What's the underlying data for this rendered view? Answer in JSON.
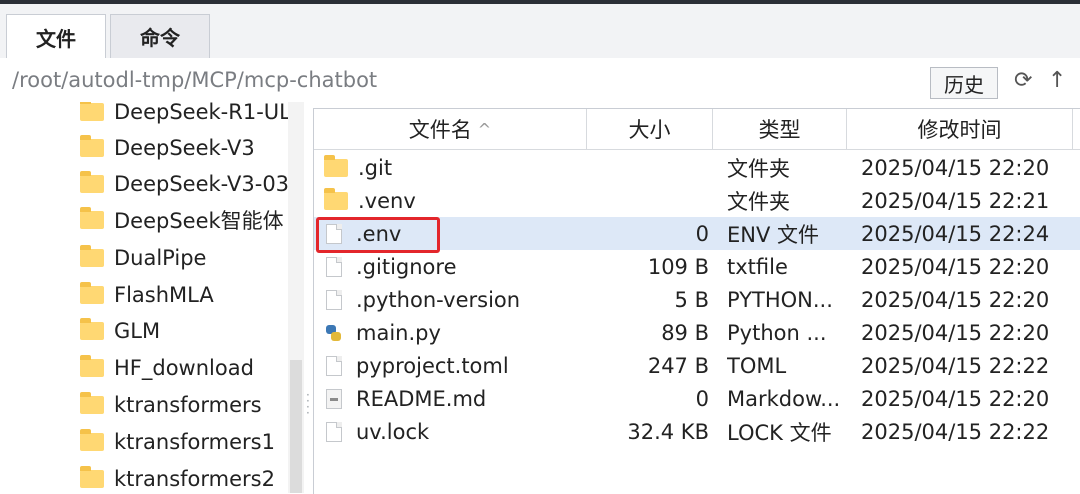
{
  "tabs": [
    {
      "label": "文件",
      "active": true
    },
    {
      "label": "命令",
      "active": false
    }
  ],
  "path": {
    "value": "/root/autodl-tmp/MCP/mcp-chatbot",
    "history_button": "历史"
  },
  "toolbar_icons": [
    "refresh-icon",
    "up-arrow-icon"
  ],
  "sidebar": {
    "items": [
      "DeepSeek-R1-UL",
      "DeepSeek-V3",
      "DeepSeek-V3-03",
      "DeepSeek智能体",
      "DualPipe",
      "FlashMLA",
      "GLM",
      "HF_download",
      "ktransformers",
      "ktransformers1",
      "ktransformers2"
    ]
  },
  "filelist": {
    "columns": {
      "name": "文件名",
      "name_sort_icon": "^",
      "size": "大小",
      "type": "类型",
      "modified": "修改时间"
    },
    "rows": [
      {
        "icon": "folder-icon",
        "name": ".git",
        "size": "",
        "type": "文件夹",
        "modified": "2025/04/15 22:20"
      },
      {
        "icon": "folder-icon",
        "name": ".venv",
        "size": "",
        "type": "文件夹",
        "modified": "2025/04/15 22:21"
      },
      {
        "icon": "file-icon",
        "name": ".env",
        "size": "0",
        "type": "ENV 文件",
        "modified": "2025/04/15 22:24",
        "selected": true
      },
      {
        "icon": "file-icon",
        "name": ".gitignore",
        "size": "109 B",
        "type": "txtfile",
        "modified": "2025/04/15 22:20"
      },
      {
        "icon": "file-icon",
        "name": ".python-version",
        "size": "5 B",
        "type": "PYTHON...",
        "modified": "2025/04/15 22:20"
      },
      {
        "icon": "python-file-icon",
        "name": "main.py",
        "size": "89 B",
        "type": "Python ...",
        "modified": "2025/04/15 22:20"
      },
      {
        "icon": "file-icon",
        "name": "pyproject.toml",
        "size": "247 B",
        "type": "TOML",
        "modified": "2025/04/15 22:22"
      },
      {
        "icon": "markdown-file-icon",
        "name": "README.md",
        "size": "0",
        "type": "Markdow...",
        "modified": "2025/04/15 22:20"
      },
      {
        "icon": "file-icon",
        "name": "uv.lock",
        "size": "32.4 KB",
        "type": "LOCK 文件",
        "modified": "2025/04/15 22:22"
      }
    ]
  },
  "colors": {
    "selection": "#dde8f7",
    "highlight_border": "#e3262b",
    "folder": "#ffd873"
  }
}
